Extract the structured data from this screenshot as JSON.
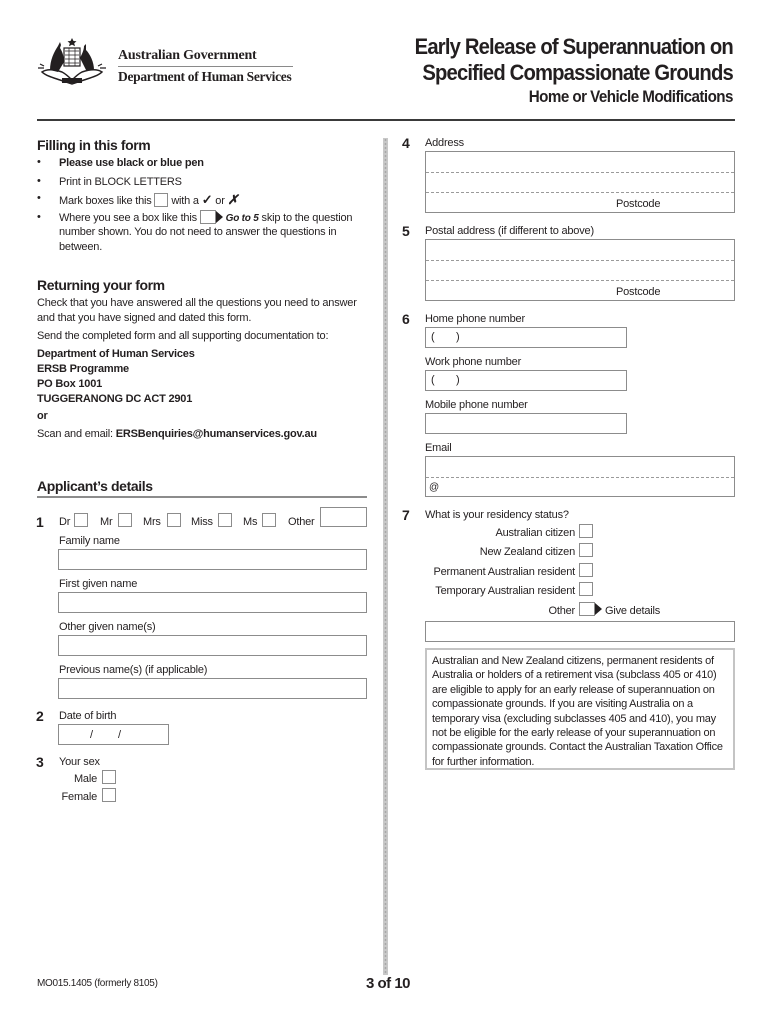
{
  "header": {
    "org_name": "Australian Government",
    "dept_name": "Department of Human Services",
    "title_line1": "Early Release of Superannuation on",
    "title_line2": "Specified Compassionate Grounds",
    "subtitle": "Home or Vehicle Modifications",
    "logo_icon": "commonwealth-coat-of-arms-icon"
  },
  "filling_in": {
    "heading": "Filling in this form",
    "bullets": [
      "Please use black or blue pen",
      "Print in BLOCK LETTERS",
      "Mark boxes like this",
      "Where you see a box like this"
    ],
    "mark_with": "with a",
    "check_glyph": "✓",
    "or": "or",
    "cross_glyph": "✗",
    "goto_label": "Go to 5",
    "skip_text_1": "skip to the question",
    "skip_text_2": "number shown. You do not need to answer the questions in",
    "skip_text_3": "between."
  },
  "returning": {
    "heading": "Returning your form",
    "para1_line1": "Check that you have answered all the questions you need to answer",
    "para1_line2": "and that you have signed and dated this form.",
    "para2": "Send the completed form and all supporting documentation to:",
    "address": [
      "Department of Human Services",
      "ERSB Programme",
      "PO Box 1001",
      "TUGGERANONG DC ACT 2901"
    ],
    "or": "or",
    "scan_label": "Scan and email:",
    "email": "ERSBenquiries@humanservices.gov.au"
  },
  "applicant": {
    "heading": "Applicant’s details",
    "q1": {
      "number": "1",
      "titles": [
        "Dr",
        "Mr",
        "Mrs",
        "Miss",
        "Ms"
      ],
      "other": "Other",
      "family_name": "Family name",
      "first_given_name": "First given name",
      "other_given_names": "Other given name(s)",
      "previous_names": "Previous name(s) (if applicable)"
    },
    "q2": {
      "number": "2",
      "label": "Date of birth",
      "separator": "/"
    },
    "q3": {
      "number": "3",
      "label": "Your sex",
      "options": [
        "Male",
        "Female"
      ]
    }
  },
  "right": {
    "q4": {
      "number": "4",
      "label": "Address",
      "postcode": "Postcode"
    },
    "q5": {
      "number": "5",
      "label": "Postal address (if different to above)",
      "postcode": "Postcode"
    },
    "q6": {
      "number": "6",
      "home_phone": "Home phone number",
      "work_phone": "Work phone number",
      "mobile_phone": "Mobile phone number",
      "email": "Email",
      "area_code_prefix": "(       )",
      "at_symbol": "@"
    },
    "q7": {
      "number": "7",
      "label": "What is your residency status?",
      "options": [
        "Australian citizen",
        "New Zealand citizen",
        "Permanent Australian resident",
        "Temporary Australian resident",
        "Other"
      ],
      "give_details": "Give details",
      "info": "Australian and New Zealand citizens, permanent residents of Australia or holders of a retirement visa (subclass 405 or 410) are eligible to apply for an early release of superannuation on compassionate grounds. If you are visiting Australia on a temporary visa (excluding subclasses 405 and 410), you may not be eligible for the early release of your superannuation on compassionate grounds. Contact the Australian Taxation Office for further information."
    }
  },
  "footer": {
    "form_code": "MO015.1405 (formerly 8105)",
    "page": "3 of 10"
  }
}
